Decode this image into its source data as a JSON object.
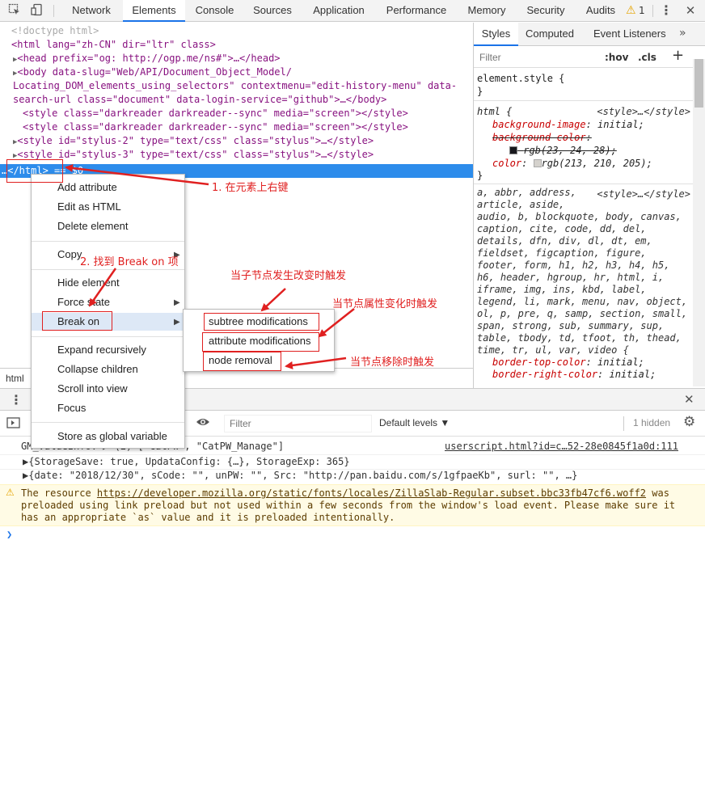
{
  "toolbar": {
    "tabs": [
      "Network",
      "Elements",
      "Console",
      "Sources",
      "Application",
      "Performance",
      "Memory",
      "Security",
      "Audits"
    ],
    "warning_count": "1"
  },
  "tree": {
    "doctype": "<!doctype html>",
    "l1": "<html lang=\"zh-CN\" dir=\"ltr\" class>",
    "l2": "<head prefix=\"og: http://ogp.me/ns#\">…</head>",
    "l3": "<body data-slug=\"Web/API/Document_Object_Model/",
    "l4": "Locating_DOM_elements_using_selectors\" contextmenu=\"edit-history-menu\" data-",
    "l5": "search-url class=\"document\" data-login-service=\"github\">…</body>",
    "l6": "<style class=\"darkreader darkreader--sync\" media=\"screen\"></style>",
    "l7": "<style class=\"darkreader darkreader--sync\" media=\"screen\"></style>",
    "l8": "<style id=\"stylus-2\" type=\"text/css\" class=\"stylus\">…</style>",
    "l9": "<style id=\"stylus-3\" type=\"text/css\" class=\"stylus\">…</style>",
    "selected_prefix": "…",
    "selected": "</html>",
    "selected_suffix": " == $0"
  },
  "breadcrumb": "html",
  "context_menu": {
    "items": [
      "Add attribute",
      "Edit as HTML",
      "Delete element",
      "Copy",
      "Hide element",
      "Force state",
      "Break on",
      "Expand recursively",
      "Collapse children",
      "Scroll into view",
      "Focus",
      "Store as global variable"
    ]
  },
  "submenu": {
    "items": [
      "subtree modifications",
      "attribute modifications",
      "node removal"
    ]
  },
  "annotations": {
    "a1": "1. 在元素上右键",
    "a2": "2. 找到 Break on 项",
    "a3": "当子节点发生改变时触发",
    "a4": "当节点属性变化时触发",
    "a5": "当节点移除时触发"
  },
  "styles": {
    "tabs": [
      "Styles",
      "Computed",
      "Event Listeners"
    ],
    "filter_placeholder": "Filter",
    "hov": ":hov",
    "cls": ".cls",
    "element_style": "element.style {",
    "close_brace": "}",
    "rule1_selector": "html {",
    "rule1_source": "<style>…</style>",
    "rule1_props": [
      {
        "name": "background-image",
        "value": "initial;"
      },
      {
        "name": "background-color",
        "value": ""
      },
      {
        "name": "",
        "value": "rgb(23, 24, 28);"
      },
      {
        "name": "color",
        "value": "rgb(213, 210, 205);"
      }
    ],
    "rule2_source": "<style>…</style>",
    "rule2_selectors": [
      "a, abbr, address,",
      "article, aside,",
      "audio, b, blockquote, body, canvas,",
      "caption, cite, code, dd, del,",
      "details, dfn, div, dl, dt, em,",
      "fieldset, figcaption, figure,",
      "footer, form, h1, h2, h3, h4, h5,",
      "h6, header, hgroup, hr, html, i,",
      "iframe, img, ins, kbd, label,",
      "legend, li, mark, menu, nav, object,",
      "ol, p, pre, q, samp, section, small,",
      "span, strong, sub, summary, sup,",
      "table, tbody, td, tfoot, th, thead,",
      "time, tr, ul, var, video {"
    ],
    "rule2_props": [
      {
        "name": "border-top-color",
        "value": "initial;"
      },
      {
        "name": "border-right-color",
        "value": "initial;"
      }
    ],
    "swatch1": "#17181c",
    "swatch2": "#d5d2cd"
  },
  "console": {
    "filter_placeholder": "Filter",
    "levels": "Default levels ▼",
    "hidden": "1 hidden",
    "line1": "GM_ValueInfo: ▶ (2) [\"CatPW\", \"CatPW_Manage\"]",
    "line1_src": "userscript.html?id=c…52-28e0845f1a0d:111",
    "line2": "▶{StorageSave: true, UpdataConfig: {…}, StorageExp: 365}",
    "line3": "▶{date: \"2018/12/30\", sCode: \"\", unPW: \"\", Src: \"http://pan.baidu.com/s/1gfpaeKb\", surl: \"\", …}",
    "warn1a": "The resource ",
    "warn1_link": "https://developer.mozilla.org/static/fonts/locales/ZillaSlab-Regular.subset.bbc33fb47cf6.woff2",
    "warn1b": " was",
    "warn2": "preloaded using link preload but not used within a few seconds from the window's load event. Please make sure it",
    "warn3": "has an appropriate `as` value and it is preloaded intentionally.",
    "prompt": "❯"
  },
  "colors": {
    "accent": "#1a73e8",
    "selection": "#2d8ceb",
    "annotation": "#e02020"
  }
}
